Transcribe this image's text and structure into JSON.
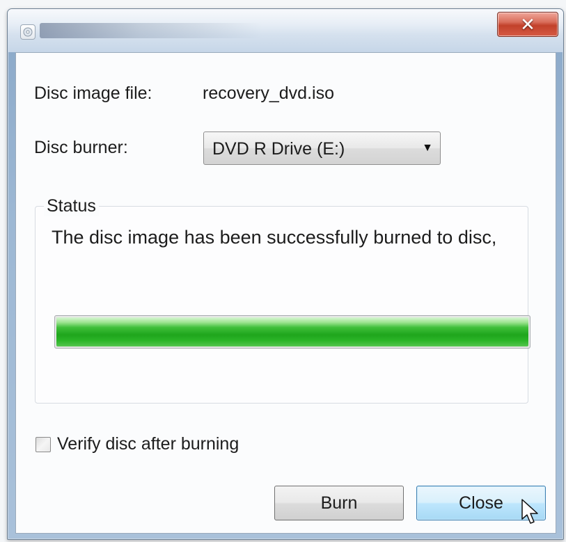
{
  "window": {
    "title": "",
    "close_glyph": "✕",
    "icon": "disc-image-burner-icon"
  },
  "form": {
    "image_file_label": "Disc image file:",
    "image_file_value": "recovery_dvd.iso",
    "burner_label": "Disc burner:",
    "burner_selected": "DVD R Drive (E:)",
    "dropdown_arrow": "▼"
  },
  "status": {
    "title": "Status",
    "message": "The disc image has been successfully burned to disc,",
    "progress_fraction": 1.0
  },
  "options": {
    "verify_label": "Verify disc after burning",
    "verify_checked": false
  },
  "buttons": {
    "burn_label": "Burn",
    "close_label": "Close"
  },
  "colors": {
    "progress_green": "#1fa51c",
    "close_button_red": "#c2412b",
    "focused_button_blue": "#bee6fd"
  }
}
